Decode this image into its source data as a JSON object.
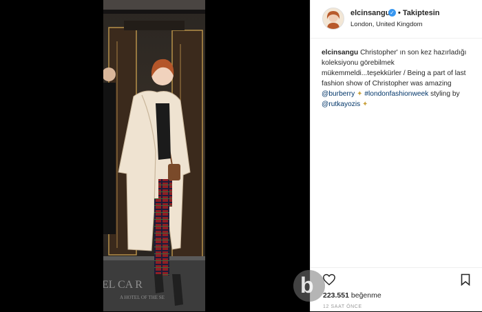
{
  "post": {
    "username": "elcinsangu",
    "follow_status": "• Takiptesin",
    "location": "London, United Kingdom",
    "caption": {
      "username": "elcinsangu",
      "text": "Christopher' ın son kez hazırladığı koleksiyonu görebilmek mükemmeldi...teşekkürler / Being a part of last fashion show of Christopher was amazing",
      "mention_1": "@burberry",
      "hashtag": "#londonfashionweek",
      "styling_text": "styling by",
      "mention_2": "@rutkayozis"
    },
    "likes_count": "223.551",
    "likes_label": "beğenme",
    "timestamp": "12 SAAT ÖNCE"
  },
  "photo": {
    "sign_text": "EL CA    R",
    "sign_subtext": "A HOTEL OF THE SE"
  },
  "icons": {
    "verified": "verified-badge",
    "heart": "heart-icon",
    "bookmark": "bookmark-icon",
    "sparkle": "sparkle-emoji"
  },
  "colors": {
    "link": "#003569",
    "verified": "#3897f0"
  }
}
